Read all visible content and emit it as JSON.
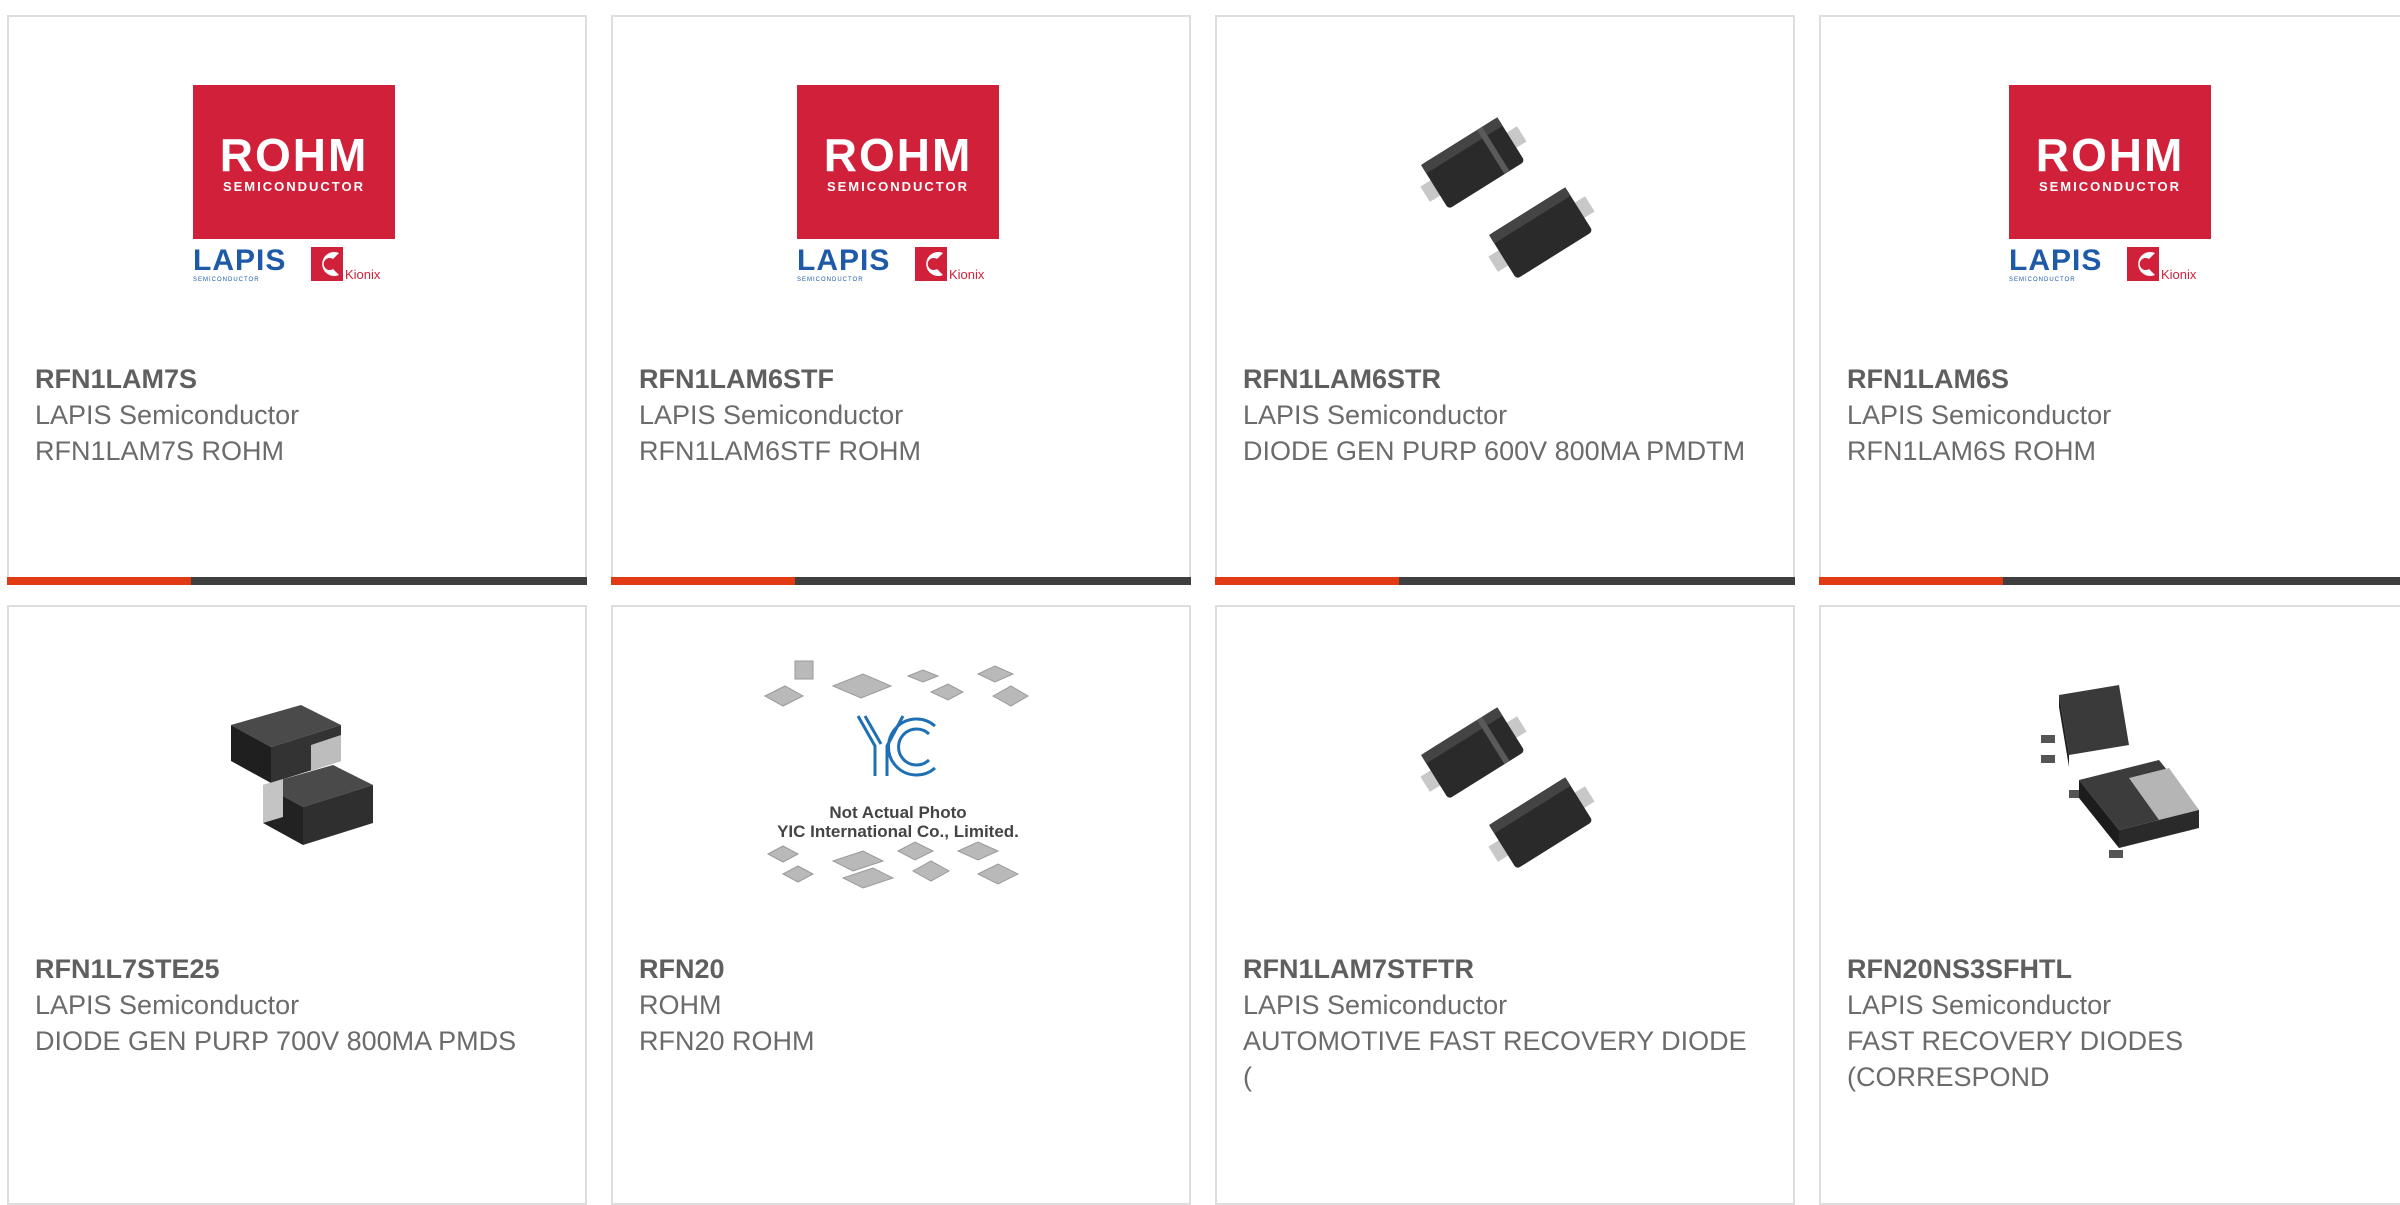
{
  "products": [
    {
      "part_number": "RFN1LAM7S",
      "manufacturer": "LAPIS Semiconductor",
      "description": "RFN1LAM7S ROHM",
      "image": "rohm-lapis-logo"
    },
    {
      "part_number": "RFN1LAM6STF",
      "manufacturer": "LAPIS Semiconductor",
      "description": "RFN1LAM6STF ROHM",
      "image": "rohm-lapis-logo"
    },
    {
      "part_number": "RFN1LAM6STR",
      "manufacturer": "LAPIS Semiconductor",
      "description": "DIODE GEN PURP 600V 800MA PMDTM",
      "image": "smd-diode-pair"
    },
    {
      "part_number": "RFN1LAM6S",
      "manufacturer": "LAPIS Semiconductor",
      "description": "RFN1LAM6S ROHM",
      "image": "rohm-lapis-logo"
    },
    {
      "part_number": "RFN1L7STE25",
      "manufacturer": "LAPIS Semiconductor",
      "description": "DIODE GEN PURP 700V 800MA PMDS",
      "image": "smd-diode-3d"
    },
    {
      "part_number": "RFN20",
      "manufacturer": "ROHM",
      "description": "RFN20 ROHM",
      "image": "not-actual-photo"
    },
    {
      "part_number": "RFN1LAM7STFTR",
      "manufacturer": "LAPIS Semiconductor",
      "description": "AUTOMOTIVE FAST RECOVERY DIODE (",
      "image": "smd-diode-pair"
    },
    {
      "part_number": "RFN20NS3SFHTL",
      "manufacturer": "LAPIS Semiconductor",
      "description": "FAST RECOVERY DIODES (CORRESPOND",
      "image": "dpak-package"
    }
  ],
  "logo": {
    "brand": "ROHM",
    "brand_sub": "SEMICONDUCTOR",
    "lapis": "LAPIS",
    "lapis_sub": "SEMICONDUCTOR",
    "kionix": "Kionix"
  },
  "placeholder": {
    "line1": "Not Actual Photo",
    "line2": "YIC International Co., Limited.",
    "logo_text": "YIC"
  },
  "colors": {
    "accent": "#e23a12",
    "bar": "#3f3f3f",
    "rohm_red": "#d0203a",
    "lapis_blue": "#1e5aa8"
  }
}
